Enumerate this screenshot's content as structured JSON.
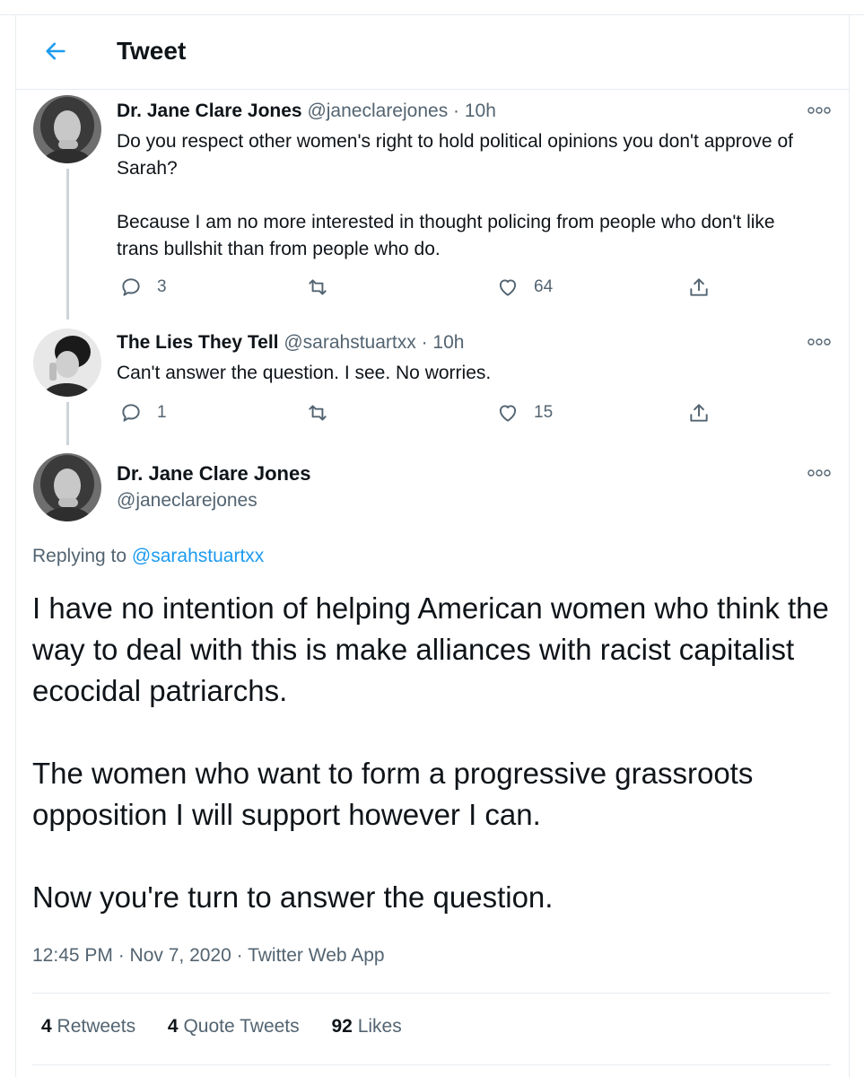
{
  "header": {
    "title": "Tweet"
  },
  "tweets": [
    {
      "name": "Dr. Jane Clare Jones",
      "handle": "@janeclarejones",
      "time": "· 10h",
      "text": "Do you respect other women's right to hold political opinions you don't approve of Sarah?\n\nBecause I am no more interested in thought policing from people who don't like trans bullshit than from people who do.",
      "replies": "3",
      "likes": "64"
    },
    {
      "name": "The Lies They Tell",
      "handle": "@sarahstuartxx",
      "time": "· 10h",
      "text": "Can't answer the question.  I see.  No worries.",
      "replies": "1",
      "likes": "15"
    }
  ],
  "main": {
    "name": "Dr. Jane Clare Jones",
    "handle": "@janeclarejones",
    "replying_prefix": "Replying to",
    "replying_to": "@sarahstuartxx",
    "text": "I have no intention of helping American women who think the way to deal with this is make alliances with racist capitalist ecocidal patriarchs.\n\nThe women who want to form a progressive grassroots opposition I will support however I can.\n\nNow you're turn to answer the question.",
    "meta": "12:45 PM · Nov 7, 2020 · Twitter Web App",
    "stats": {
      "retweets_count": "4",
      "retweets_label": "Retweets",
      "quotes_count": "4",
      "quotes_label": "Quote Tweets",
      "likes_count": "92",
      "likes_label": "Likes"
    }
  },
  "colors": {
    "accent": "#1d9bf0",
    "muted": "#536471",
    "text": "#0f1419",
    "divider": "#e6ecf0"
  },
  "icons": [
    "back-arrow-icon",
    "more-icon",
    "reply-icon",
    "retweet-icon",
    "like-icon",
    "share-icon"
  ]
}
